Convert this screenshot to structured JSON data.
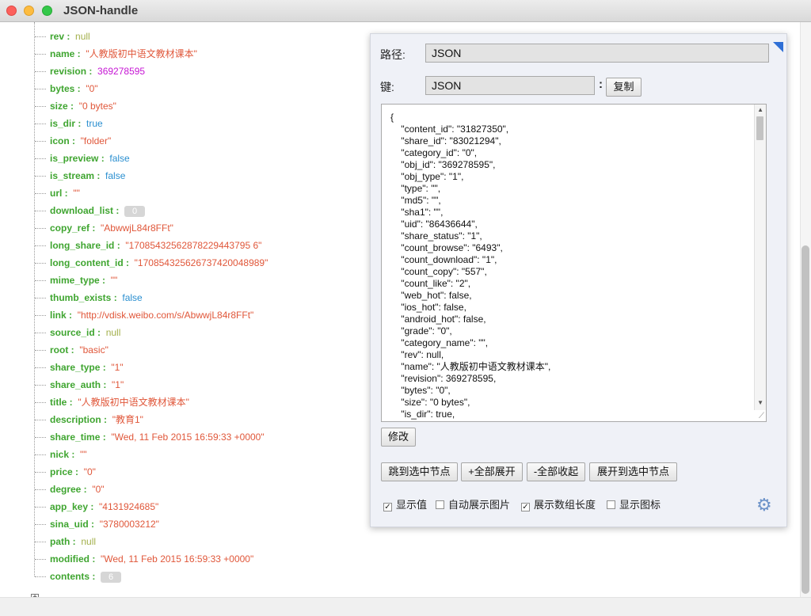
{
  "window": {
    "title": "JSON-handle"
  },
  "tree": {
    "rows": [
      {
        "key": "rev :",
        "value": "null",
        "type": "null"
      },
      {
        "key": "name :",
        "value": "\"人教版初中语文教材课本\"",
        "type": "str"
      },
      {
        "key": "revision :",
        "value": "369278595",
        "type": "num"
      },
      {
        "key": "bytes :",
        "value": "\"0\"",
        "type": "str"
      },
      {
        "key": "size :",
        "value": "\"0 bytes\"",
        "type": "str"
      },
      {
        "key": "is_dir :",
        "value": "true",
        "type": "bool"
      },
      {
        "key": "icon :",
        "value": "\"folder\"",
        "type": "str"
      },
      {
        "key": "is_preview :",
        "value": "false",
        "type": "bool"
      },
      {
        "key": "is_stream :",
        "value": "false",
        "type": "bool"
      },
      {
        "key": "url :",
        "value": "\"\"",
        "type": "str"
      },
      {
        "key": "download_list :",
        "value": "0",
        "type": "cnt"
      },
      {
        "key": "copy_ref :",
        "value": "\"AbwwjL84r8FFt\"",
        "type": "str"
      },
      {
        "key": "long_share_id :",
        "value": "\"17085432562878229443795 6\"",
        "type": "str"
      },
      {
        "key": "long_content_id :",
        "value": "\"170854325626737420048989\"",
        "type": "str"
      },
      {
        "key": "mime_type :",
        "value": "\"\"",
        "type": "str"
      },
      {
        "key": "thumb_exists :",
        "value": "false",
        "type": "bool"
      },
      {
        "key": "link :",
        "value": "\"http://vdisk.weibo.com/s/AbwwjL84r8FFt\"",
        "type": "str"
      },
      {
        "key": "source_id :",
        "value": "null",
        "type": "null"
      },
      {
        "key": "root :",
        "value": "\"basic\"",
        "type": "str"
      },
      {
        "key": "share_type :",
        "value": "\"1\"",
        "type": "str"
      },
      {
        "key": "share_auth :",
        "value": "\"1\"",
        "type": "str"
      },
      {
        "key": "title :",
        "value": "\"人教版初中语文教材课本\"",
        "type": "str"
      },
      {
        "key": "description :",
        "value": "\"教育1\"",
        "type": "str"
      },
      {
        "key": "share_time :",
        "value": "\"Wed, 11 Feb 2015 16:59:33 +0000\"",
        "type": "str"
      },
      {
        "key": "nick :",
        "value": "\"\"",
        "type": "str"
      },
      {
        "key": "price :",
        "value": "\"0\"",
        "type": "str"
      },
      {
        "key": "degree :",
        "value": "\"0\"",
        "type": "str"
      },
      {
        "key": "app_key :",
        "value": "\"4131924685\"",
        "type": "str"
      },
      {
        "key": "sina_uid :",
        "value": "\"3780003212\"",
        "type": "str"
      },
      {
        "key": "path :",
        "value": "null",
        "type": "null"
      },
      {
        "key": "modified :",
        "value": "\"Wed, 11 Feb 2015 16:59:33 +0000\"",
        "type": "str"
      },
      {
        "key": "contents :",
        "value": "6",
        "type": "cnt"
      }
    ]
  },
  "panel": {
    "path_label": "路径:",
    "path_value": "JSON",
    "key_label": "键:",
    "key_value": "JSON",
    "colon": ":",
    "copy_label": "复制",
    "json_text": "{\n    \"content_id\": \"31827350\",\n    \"share_id\": \"83021294\",\n    \"category_id\": \"0\",\n    \"obj_id\": \"369278595\",\n    \"obj_type\": \"1\",\n    \"type\": \"\",\n    \"md5\": \"\",\n    \"sha1\": \"\",\n    \"uid\": \"86436644\",\n    \"share_status\": \"1\",\n    \"count_browse\": \"6493\",\n    \"count_download\": \"1\",\n    \"count_copy\": \"557\",\n    \"count_like\": \"2\",\n    \"web_hot\": false,\n    \"ios_hot\": false,\n    \"android_hot\": false,\n    \"grade\": \"0\",\n    \"category_name\": \"\",\n    \"rev\": null,\n    \"name\": \"人教版初中语文教材课本\",\n    \"revision\": 369278595,\n    \"bytes\": \"0\",\n    \"size\": \"0 bytes\",\n    \"is_dir\": true,",
    "modify_label": "修改",
    "buttons": {
      "jump": "跳到选中节点",
      "expand_all": "+全部展开",
      "collapse_all": "-全部收起",
      "expand_to": "展开到选中节点"
    },
    "checks": {
      "show_value": "显示值",
      "auto_image": "自动展示图片",
      "array_len": "展示数组长度",
      "show_icon": "显示图标"
    }
  }
}
